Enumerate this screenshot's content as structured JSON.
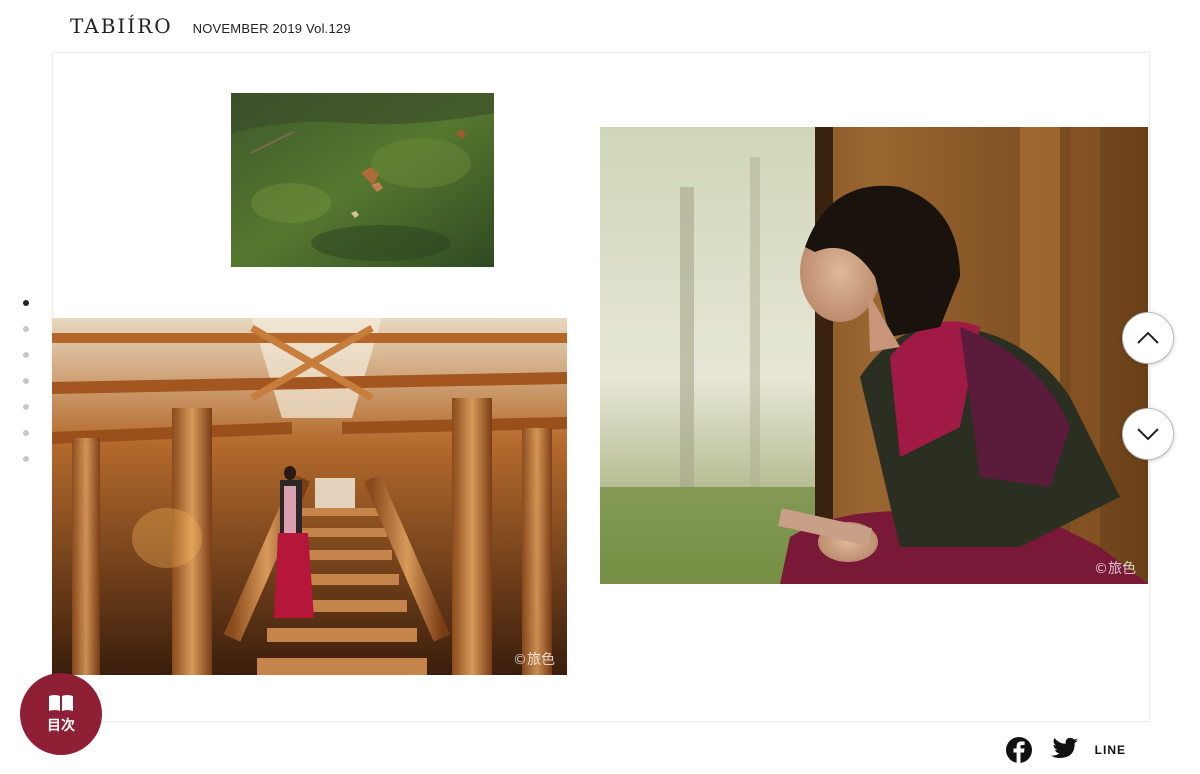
{
  "header": {
    "logo": "TABIÍRO",
    "issue": "NOVEMBER  2019  Vol.129"
  },
  "photos": {
    "grass": {
      "alt": "moss-and-leaves"
    },
    "staircase": {
      "credit": "©旅色"
    },
    "window": {
      "credit": "©旅色"
    }
  },
  "page_indicator": {
    "total": 7,
    "active": 1
  },
  "nav": {
    "up": "chevron-up-icon",
    "down": "chevron-down-icon"
  },
  "toc": {
    "label": "目次"
  },
  "share": {
    "line": "LINE"
  },
  "colors": {
    "toc_bg": "#8f1f35",
    "dot_active": "#222222",
    "dot_inactive": "#c8c8c8"
  }
}
